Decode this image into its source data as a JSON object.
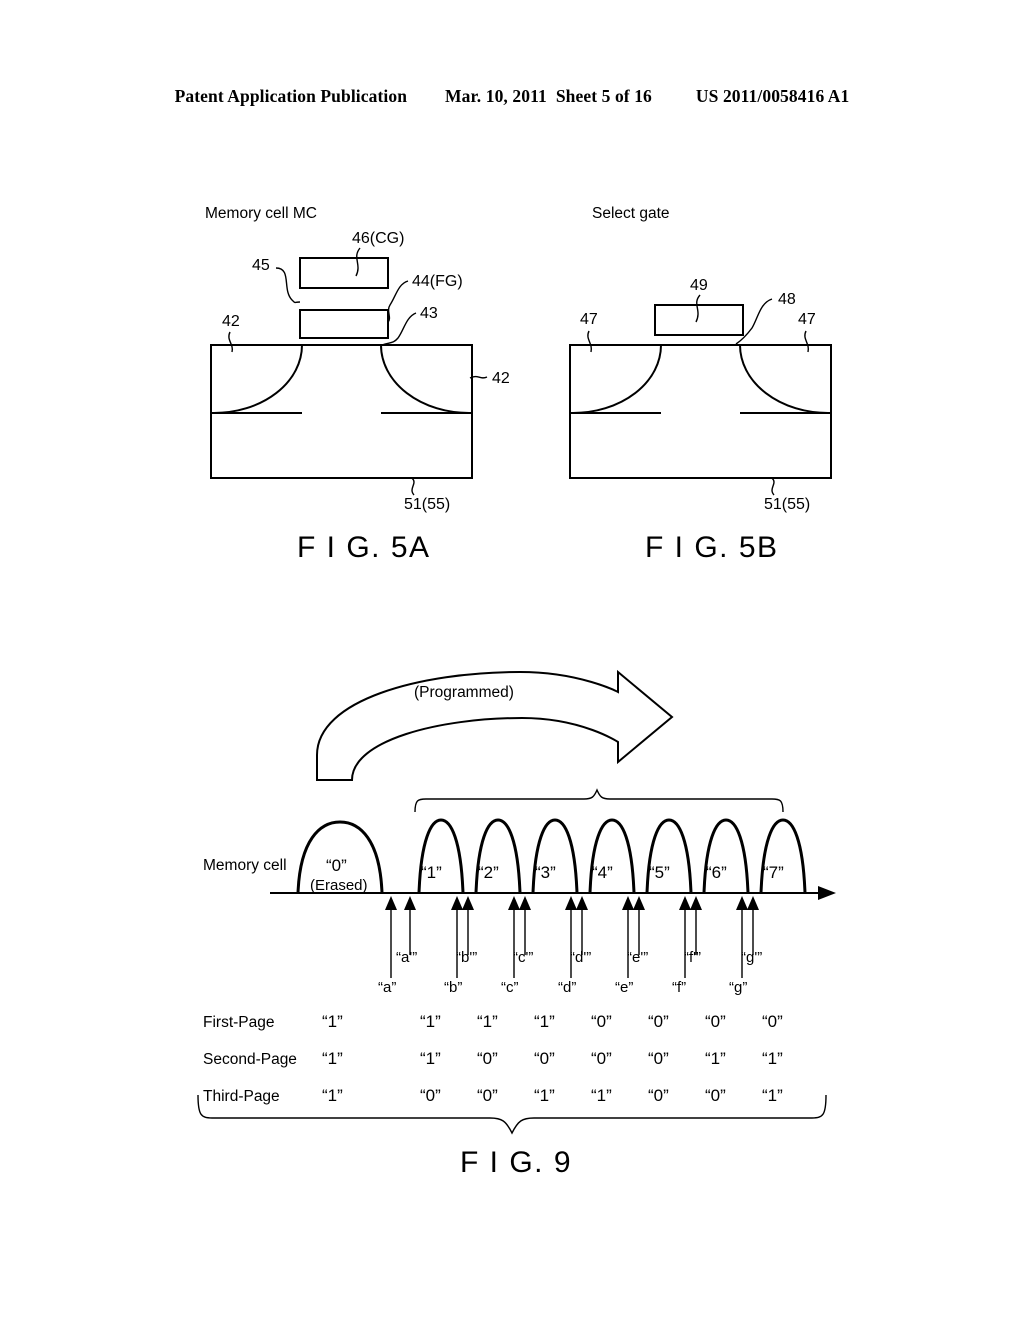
{
  "header": {
    "title": "Patent Application Publication",
    "date": "Mar. 10, 2011",
    "sheet": "Sheet 5 of 16",
    "number": "US 2011/0058416 A1"
  },
  "figures": {
    "fig5a": {
      "caption": "F I G. 5A",
      "title": "Memory cell MC",
      "labels": {
        "control_gate": "46(CG)",
        "ipd": "45",
        "floating_gate": "44(FG)",
        "tunnel_oxide": "43",
        "substrate_left": "42",
        "substrate_right": "42",
        "well": "51(55)"
      }
    },
    "fig5b": {
      "caption": "F I G. 5B",
      "title": "Select gate",
      "labels": {
        "gate": "49",
        "gate_oxide": "48",
        "diffusion_left": "47",
        "diffusion_right": "47",
        "well": "51(55)"
      }
    },
    "fig9": {
      "caption": "F I G. 9",
      "programmed_label": "(Programmed)",
      "row_label": "Memory cell",
      "erased_label": "(Erased)",
      "states": [
        "“0”",
        "“1”",
        "“2”",
        "“3”",
        "“4”",
        "“5”",
        "“6”",
        "“7”"
      ],
      "verify_lower": [
        "“a”",
        "“b”",
        "“c”",
        "“d”",
        "“e”",
        "“f”",
        "“g”"
      ],
      "verify_upper": [
        "“a'”",
        "“b'”",
        "“c'”",
        "“d'”",
        "“e'”",
        "“f'”",
        "“g'”"
      ],
      "page_rows": [
        {
          "name": "First-Page",
          "values": [
            "“1”",
            "“1”",
            "“1”",
            "“1”",
            "“0”",
            "“0”",
            "“0”",
            "“0”"
          ]
        },
        {
          "name": "Second-Page",
          "values": [
            "“1”",
            "“1”",
            "“0”",
            "“0”",
            "“0”",
            "“0”",
            "“1”",
            "“1”"
          ]
        },
        {
          "name": "Third-Page",
          "values": [
            "“1”",
            "“0”",
            "“0”",
            "“1”",
            "“1”",
            "“0”",
            "“0”",
            "“1”"
          ]
        }
      ]
    }
  },
  "chart_data": {
    "type": "line",
    "title": "F I G. 9",
    "xlabel": "",
    "ylabel": "Memory cell",
    "annotations": [
      "(Programmed)",
      "(Erased)"
    ],
    "categories": [
      "“0”",
      "“1”",
      "“2”",
      "“3”",
      "“4”",
      "“5”",
      "“6”",
      "“7”"
    ],
    "distribution_centers": [
      340,
      440,
      497,
      554,
      611,
      668,
      725,
      782
    ],
    "distribution_widths": [
      86,
      44,
      44,
      44,
      44,
      44,
      44,
      44
    ],
    "verify_levels_lower": [
      "“a”",
      "“b”",
      "“c”",
      "“d”",
      "“e”",
      "“f”",
      "“g”"
    ],
    "verify_levels_upper": [
      "“a'”",
      "“b'”",
      "“c'”",
      "“d'”",
      "“e'”",
      "“f'”",
      "“g'”"
    ],
    "series": [
      {
        "name": "First-Page",
        "values": [
          1,
          1,
          1,
          1,
          0,
          0,
          0,
          0
        ]
      },
      {
        "name": "Second-Page",
        "values": [
          1,
          1,
          0,
          0,
          0,
          0,
          1,
          1
        ]
      },
      {
        "name": "Third-Page",
        "values": [
          1,
          0,
          0,
          1,
          1,
          0,
          0,
          1
        ]
      }
    ]
  }
}
